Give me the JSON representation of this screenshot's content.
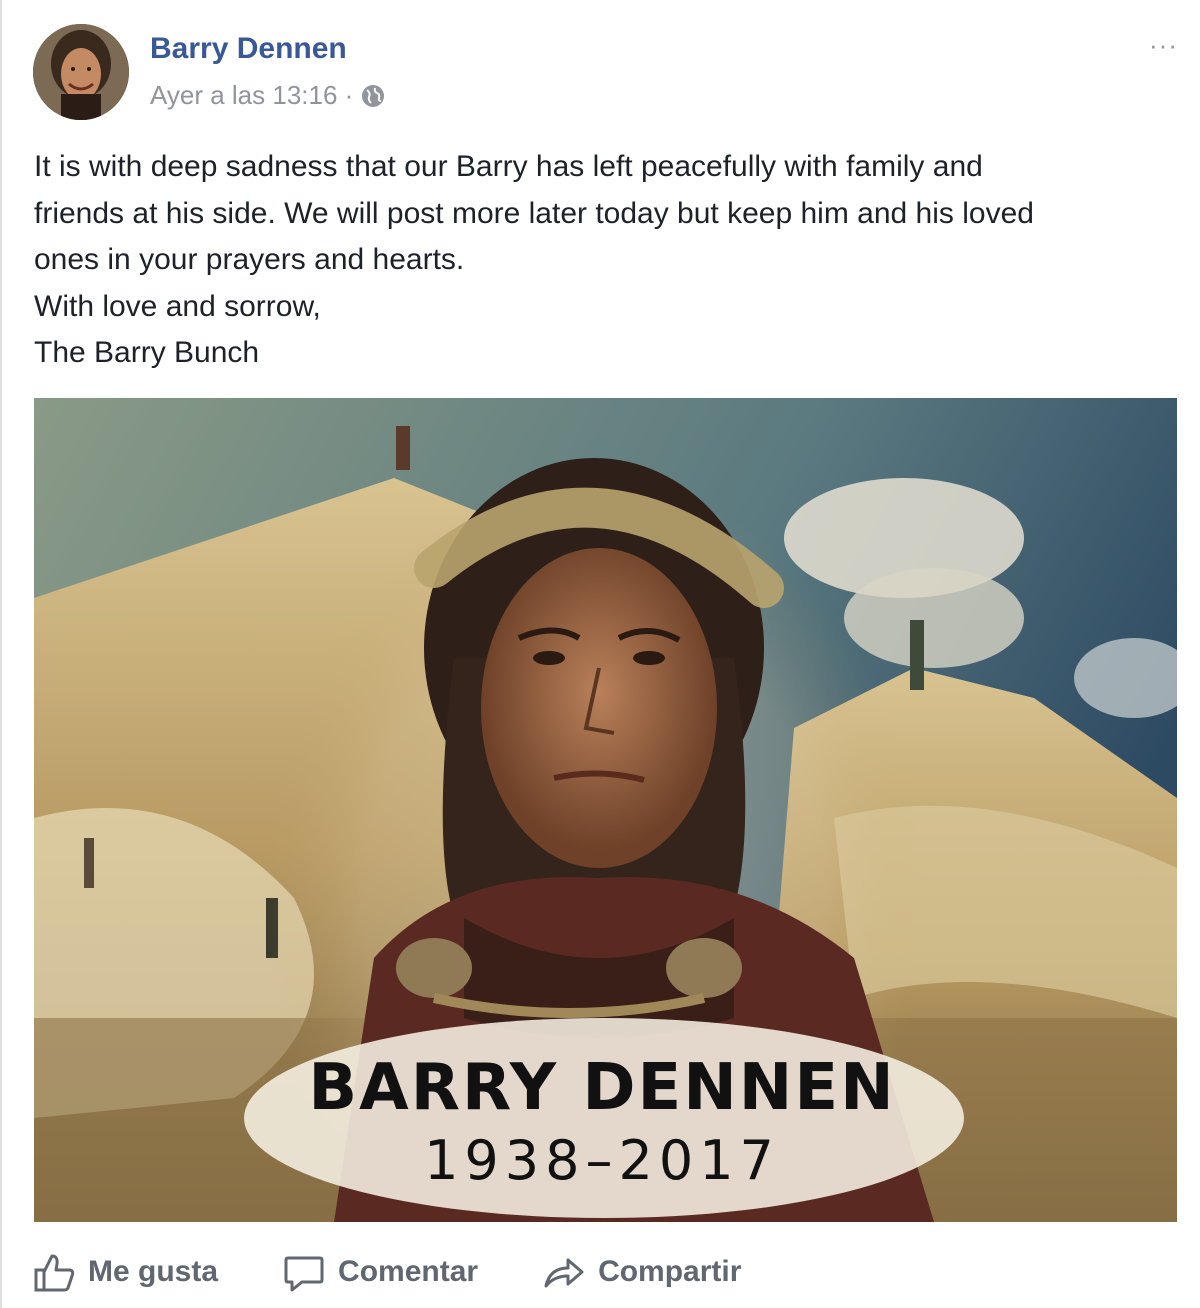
{
  "post": {
    "author": "Barry Dennen",
    "timestamp": "Ayer a las 13:16 ·",
    "privacy_icon": "globe-icon",
    "more_label": "···",
    "body_lines": [
      "It is with deep sadness that our Barry has left peacefully with family and",
      "friends at his side. We will post more later today but keep him and his loved",
      "ones in your prayers and hearts.",
      "With love and sorrow,",
      "The Barry Bunch"
    ],
    "image": {
      "title": "BARRY DENNEN",
      "years": "1938–2017"
    }
  },
  "actions": {
    "like": "Me gusta",
    "comment": "Comentar",
    "share": "Compartir"
  },
  "colors": {
    "author": "#385898",
    "meta": "#90949c",
    "action": "#606770"
  }
}
